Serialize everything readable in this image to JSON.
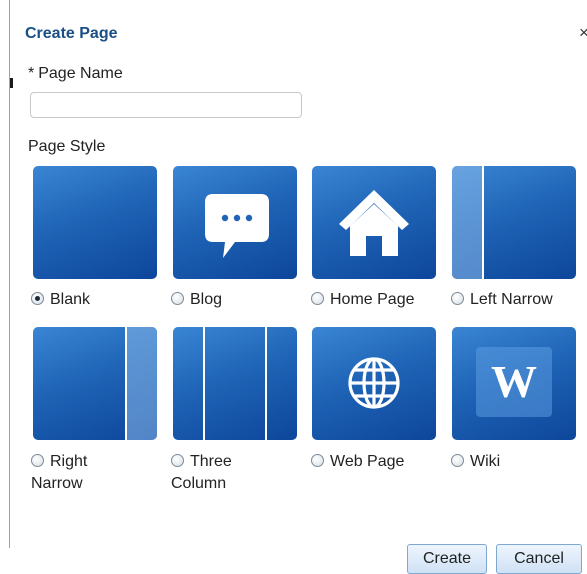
{
  "dialog": {
    "title": "Create Page",
    "close_glyph": "×",
    "required_marker": "*",
    "page_name_label": "Page Name",
    "page_name_value": "",
    "page_style_label": "Page Style",
    "selected_style": "Blank",
    "styles": [
      {
        "label": "Blank",
        "icon": "blank-tile-icon"
      },
      {
        "label": "Blog",
        "icon": "speech-bubble-icon"
      },
      {
        "label": "Home Page",
        "icon": "house-icon"
      },
      {
        "label": "Left Narrow",
        "icon": "left-narrow-layout-icon"
      },
      {
        "label": "Right Narrow",
        "line1": "Right",
        "line2": "Narrow",
        "icon": "right-narrow-layout-icon"
      },
      {
        "label": "Three Column",
        "line1": "Three",
        "line2": "Column",
        "icon": "three-column-layout-icon"
      },
      {
        "label": "Web Page",
        "icon": "globe-icon"
      },
      {
        "label": "Wiki",
        "icon": "wiki-w-icon",
        "glyph": "W"
      }
    ],
    "buttons": {
      "create": "Create",
      "cancel": "Cancel"
    },
    "colors": {
      "title": "#1a4f85",
      "tile_top": "#3a85d4",
      "tile_bottom": "#0d469b"
    }
  }
}
